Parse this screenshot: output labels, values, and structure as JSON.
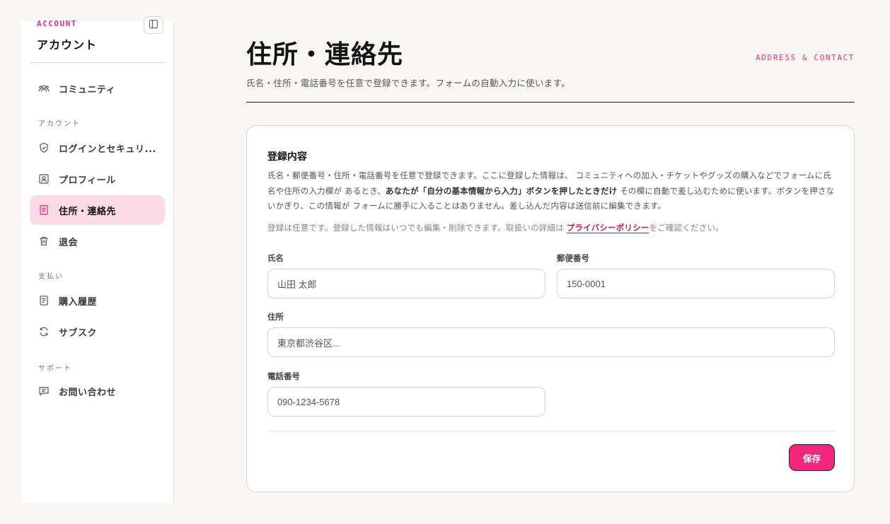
{
  "sidebar": {
    "kicker": "ACCOUNT",
    "title": "アカウント",
    "toggle_icon": "sidebar-panel-icon",
    "items": [
      {
        "label": "コミュニティ",
        "icon": "people-icon"
      },
      {
        "label": "ログインとセキュリ...",
        "icon": "shield-icon"
      },
      {
        "label": "プロフィール",
        "icon": "user-card-icon"
      },
      {
        "label": "住所・連絡先",
        "icon": "document-list-icon",
        "active": true
      },
      {
        "label": "退会",
        "icon": "trash-icon"
      },
      {
        "label": "購入履歴",
        "icon": "receipt-icon"
      },
      {
        "label": "サブスク",
        "icon": "refresh-icon"
      },
      {
        "label": "お問い合わせ",
        "icon": "message-icon"
      }
    ],
    "sections": {
      "account": "アカウント",
      "payment": "支払い",
      "support": "サポート"
    }
  },
  "page": {
    "title": "住所・連絡先",
    "kicker": "ADDRESS & CONTACT",
    "subtitle": "氏名・住所・電話番号を任意で登録できます。フォームの自動入力に使います。"
  },
  "card": {
    "title": "登録内容",
    "desc_1": "氏名・郵便番号・住所・電話番号を任意で登録できます。ここに登録した情報は、 コミュニティへの加入・チケットやグッズの購入などでフォームに氏名や住所の入力欄が あるとき、",
    "desc_bold": "あなたが「自分の基本情報から入力」ボタンを押したときだけ",
    "desc_2": " その欄に自動で差し込むために使います。ボタンを押さないかぎり、この情報が フォームに勝手に入ることはありません。差し込んだ内容は送信前に編集できます。",
    "note_1": "登録は任意です。登録した情報はいつでも編集・削除できます。取扱いの詳細は ",
    "note_link": "プライバシーポリシー",
    "note_2": "をご確認ください。",
    "fields": {
      "name": {
        "label": "氏名",
        "placeholder": "山田 太郎"
      },
      "postal": {
        "label": "郵便番号",
        "placeholder": "150-0001"
      },
      "address": {
        "label": "住所",
        "placeholder": "東京都渋谷区..."
      },
      "phone": {
        "label": "電話番号",
        "placeholder": "090-1234-5678"
      }
    },
    "save_label": "保存"
  },
  "colors": {
    "accent": "#f2267a",
    "accent_text": "#e8307b",
    "active_bg": "#fddbe6",
    "background": "#f9f7f3"
  }
}
